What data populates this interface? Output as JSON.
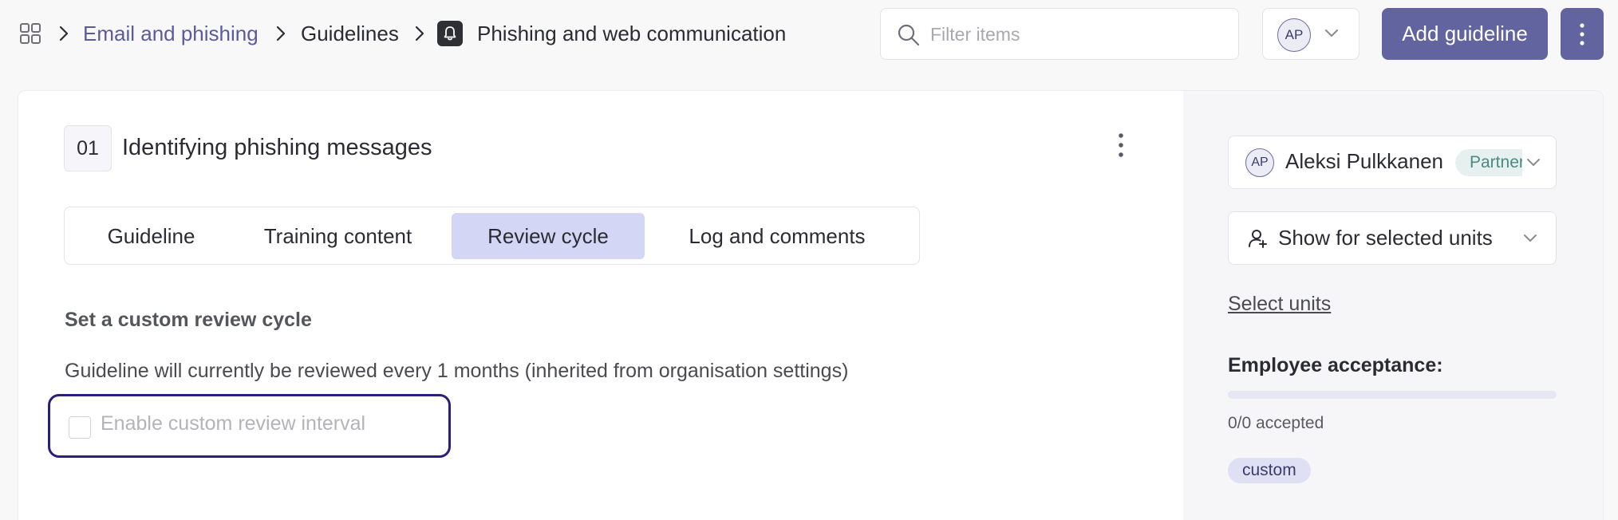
{
  "breadcrumb": {
    "section": "Email and phishing",
    "category": "Guidelines",
    "page": "Phishing and web communication"
  },
  "search": {
    "placeholder": "Filter items",
    "value": ""
  },
  "user": {
    "initials": "AP"
  },
  "actions": {
    "add_guideline": "Add guideline"
  },
  "guideline": {
    "number": "01",
    "title": "Identifying phishing messages"
  },
  "tabs": [
    {
      "label": "Guideline",
      "active": false
    },
    {
      "label": "Training content",
      "active": false
    },
    {
      "label": "Review cycle",
      "active": true
    },
    {
      "label": "Log and comments",
      "active": false
    }
  ],
  "review": {
    "section_title": "Set a custom review cycle",
    "info": "Guideline will currently be reviewed every 1 months (inherited from organisation settings)",
    "checkbox_label": "Enable custom review interval",
    "checkbox_checked": false
  },
  "sidebar": {
    "owner": {
      "initials": "AP",
      "name": "Aleksi Pulkkanen",
      "role": "Partner"
    },
    "visibility": "Show for selected units",
    "select_units": "Select units",
    "acceptance_title": "Employee acceptance:",
    "acceptance_progress": 0,
    "accepted_text": "0/0 accepted",
    "tag": "custom"
  },
  "colors": {
    "accent": "#62649f",
    "active_tab": "#d4d6f6",
    "focus_ring": "#2a1f7a",
    "partner_badge_bg": "#e6f1ef",
    "partner_badge_text": "#4b8a82",
    "tag_bg": "#dfe0f4"
  },
  "icons": {
    "apps": "grid-icon",
    "separator": "chevron-right-icon",
    "page": "bell-icon",
    "search": "search-icon",
    "dropdown": "chevron-down-icon",
    "more": "more-vertical-icon",
    "units": "user-plus-icon"
  }
}
